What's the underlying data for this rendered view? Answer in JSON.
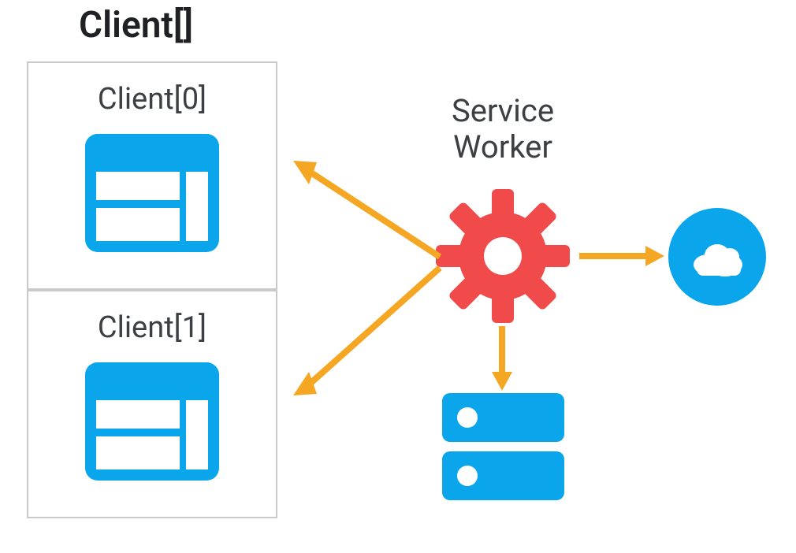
{
  "clients": {
    "title": "Client[]",
    "items": [
      {
        "label": "Client[0]"
      },
      {
        "label": "Client[1]"
      }
    ]
  },
  "service_worker": {
    "label_line1": "Service",
    "label_line2": "Worker"
  },
  "icons": {
    "browser_color": "#0BA5EC",
    "cloud_bg": "#0BA5EC",
    "server_color": "#0BA5EC",
    "gear_color": "#F04A4A",
    "arrow_color": "#F5A623"
  },
  "nodes": {
    "cloud": "cloud",
    "cache": "local-cache"
  }
}
